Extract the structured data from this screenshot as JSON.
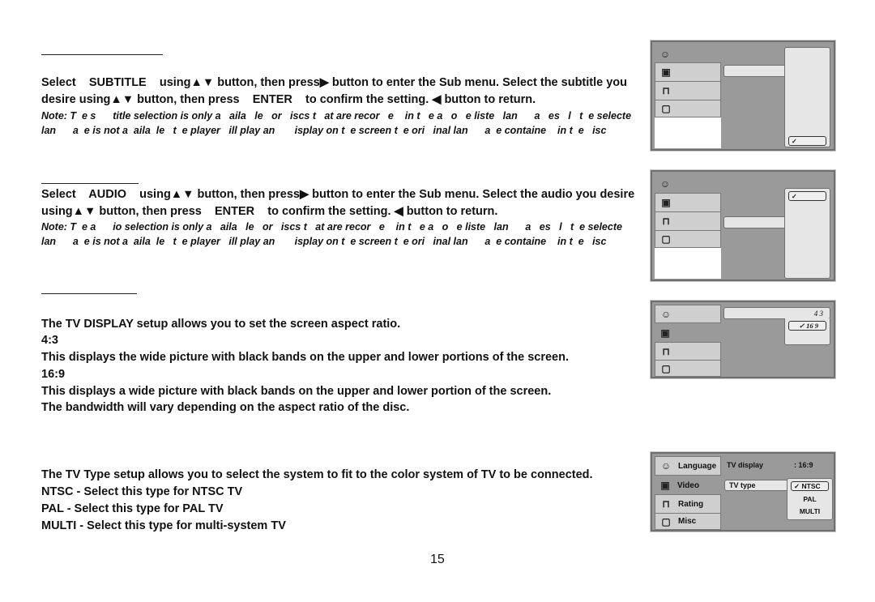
{
  "subtitle_section": {
    "line1": "Select    SUBTITLE    using▲▼ button, then press▶ button to enter the Sub menu. Select the subtitle you",
    "line2": "desire using▲▼ button, then press    ENTER    to confirm the setting. ◀ button to return.",
    "note1": "Note: T  e s      title selection is only a   aila   le   or   iscs t   at are recor   e    in t   e a   o   e liste   lan      a   es   l   t  e selecte",
    "note2": "lan      a  e is not a  aila  le   t  e player   ill play an       isplay on t  e screen t  e ori   inal lan      a  e containe    in t  e   isc"
  },
  "audio_section": {
    "line1": "Select    AUDIO    using▲▼ button, then press▶ button to enter the Sub menu. Select the audio you desire",
    "line2": "using▲▼ button, then press    ENTER    to confirm the setting. ◀ button to return.",
    "note1": "Note: T  e a      io selection is only a   aila   le   or   iscs t   at are recor   e    in t   e a   o   e liste   lan      a   es   l   t  e selecte",
    "note2": "lan      a  e is not a  aila  le   t  e player   ill play an       isplay on t  e screen t  e ori   inal lan      a  e containe    in t  e   isc"
  },
  "tv_display_section": {
    "intro": "The TV DISPLAY setup allows you to set the screen aspect ratio.",
    "opt1_title": "4:3",
    "opt1_desc": "This displays the wide picture with black bands on the upper and lower portions of the screen.",
    "opt2_title": "16:9",
    "opt2_desc1": "This displays a wide picture with black bands on the upper and lower portion of the screen.",
    "opt2_desc2": "The bandwidth will vary depending on the aspect ratio of the disc."
  },
  "tv_type_section": {
    "intro": "The TV Type setup allows you to select the system to fit to the color system of TV to be connected.",
    "ntsc": "NTSC - Select this type for NTSC TV",
    "pal": "PAL - Select this type for PAL TV",
    "multi": "MULTI - Select this type for multi-system TV"
  },
  "osd_display": {
    "options": [
      "4 3",
      "✓ 16   9"
    ]
  },
  "osd_tvtype": {
    "tabs": [
      "Language",
      "Video",
      "Rating",
      "Misc"
    ],
    "tv_display_label": "TV display",
    "tv_display_value": ": 16:9",
    "tv_type_label": "TV type",
    "options": [
      "✓ NTSC",
      "PAL",
      "MULTI"
    ]
  },
  "osd_check": "✓",
  "icons": {
    "language": "☺",
    "video": "▣",
    "rating": "🔒",
    "misc": "▯"
  },
  "page_number": "15"
}
